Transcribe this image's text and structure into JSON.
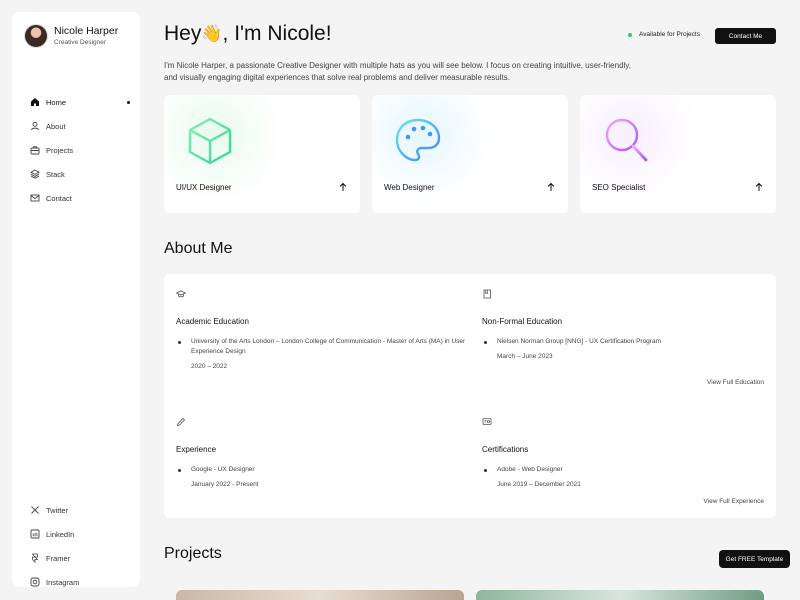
{
  "profile": {
    "name": "Nicole Harper",
    "role": "Creative Designer"
  },
  "nav": [
    {
      "label": "Home",
      "icon": "home-icon",
      "active": true
    },
    {
      "label": "About",
      "icon": "user-icon"
    },
    {
      "label": "Projects",
      "icon": "briefcase-icon"
    },
    {
      "label": "Stack",
      "icon": "layers-icon"
    },
    {
      "label": "Contact",
      "icon": "mail-icon"
    }
  ],
  "socials": [
    {
      "label": "Twitter",
      "icon": "x-icon"
    },
    {
      "label": "LinkedIn",
      "icon": "linkedin-icon"
    },
    {
      "label": "Framer",
      "icon": "framer-icon"
    },
    {
      "label": "Instagram",
      "icon": "instagram-icon"
    }
  ],
  "hero": {
    "title_before": "Hey",
    "emoji": "👋",
    "title_after": ", I'm Nicole!",
    "status": "Available for Projects",
    "contact_label": "Contact Me",
    "intro": "I'm Nicole Harper, a passionate Creative Designer with multiple hats as you will see below. I focus on creating intuitive, user-friendly, and visually engaging digital experiences that solve real problems and deliver measurable results."
  },
  "services": [
    {
      "label": "UI/UX Designer",
      "icon": "cube-icon",
      "color": "#4ade80"
    },
    {
      "label": "Web Designer",
      "icon": "palette-icon",
      "color": "#38bdf8"
    },
    {
      "label": "SEO Specialist",
      "icon": "search-icon",
      "color": "#c084fc"
    }
  ],
  "about": {
    "title": "About Me",
    "academic": {
      "title": "Academic Education",
      "item": "University of the Arts London – London College of Communication - Master of Arts (MA) in User Experience Design",
      "date": "2020 – 2022"
    },
    "nonformal": {
      "title": "Non-Formal Education",
      "item": "Nielsen Norman Group [NNG] - UX Certification Program",
      "date": "March – June 2023"
    },
    "view_education": "View Full Education",
    "experience": {
      "title": "Experience",
      "item": "Google - UX Designer",
      "date": "January 2022 - Present"
    },
    "certifications": {
      "title": "Certifications",
      "item": "Adobe - Web Designer",
      "date": "June 2019 – December 2021"
    },
    "view_experience": "View Full Experience"
  },
  "projects": {
    "title": "Projects"
  },
  "free_template": "Get FREE Template",
  "colors": {
    "status": "#2ecc71",
    "button": "#111111"
  }
}
